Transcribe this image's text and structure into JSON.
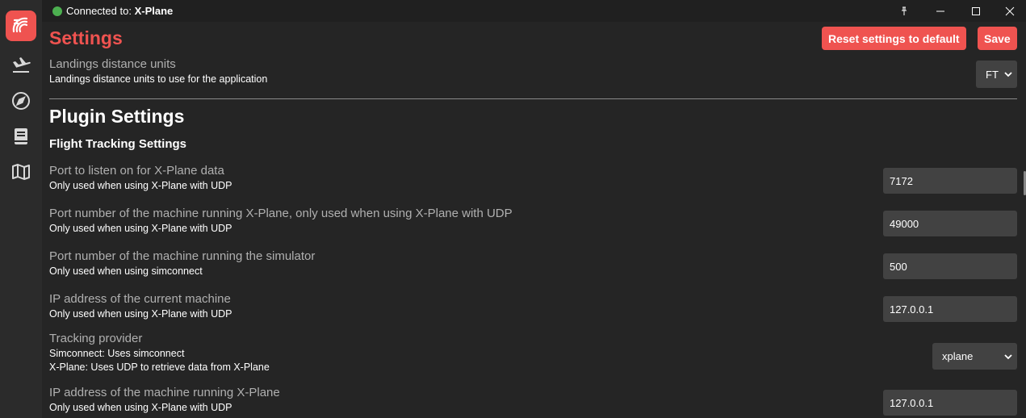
{
  "titlebar": {
    "connected_prefix": "Connected to:",
    "connected_target": "X-Plane",
    "status_color": "#4caf50",
    "controls": [
      "pin-icon",
      "minimize-icon",
      "maximize-icon",
      "close-icon"
    ]
  },
  "sidebar": {
    "items": [
      {
        "icon": "app-logo-icon",
        "active": true
      },
      {
        "icon": "plane-landing-icon",
        "active": false
      },
      {
        "icon": "compass-icon",
        "active": false
      },
      {
        "icon": "logbook-icon",
        "active": false
      },
      {
        "icon": "map-icon",
        "active": false
      }
    ]
  },
  "page": {
    "title": "Settings",
    "reset_label": "Reset settings to default",
    "save_label": "Save",
    "accent": "#ef5350"
  },
  "landing_units": {
    "label": "Landings distance units",
    "desc": "Landings distance units to use for the application",
    "value": "FT"
  },
  "plugin": {
    "heading": "Plugin Settings",
    "subheading": "Flight Tracking Settings"
  },
  "settings": {
    "xplane_port": {
      "label": "Port to listen on for X-Plane data",
      "desc": "Only used when using X-Plane with UDP",
      "value": "7172"
    },
    "xplane_machine_port": {
      "label": "Port number of the machine running X-Plane, only used when using X-Plane with UDP",
      "desc": "Only used when using X-Plane with UDP",
      "value": "49000"
    },
    "sim_port": {
      "label": "Port number of the machine running the simulator",
      "desc": "Only used when using simconnect",
      "value": "500"
    },
    "current_ip": {
      "label": "IP address of the current machine",
      "desc": "Only used when using X-Plane with UDP",
      "value": "127.0.0.1"
    },
    "provider": {
      "label": "Tracking provider",
      "desc1": "Simconnect: Uses simconnect",
      "desc2": "X-Plane: Uses UDP to retrieve data from X-Plane",
      "value": "xplane"
    },
    "xplane_ip": {
      "label": "IP address of the machine running X-Plane",
      "desc": "Only used when using X-Plane with UDP",
      "value": "127.0.0.1"
    }
  }
}
